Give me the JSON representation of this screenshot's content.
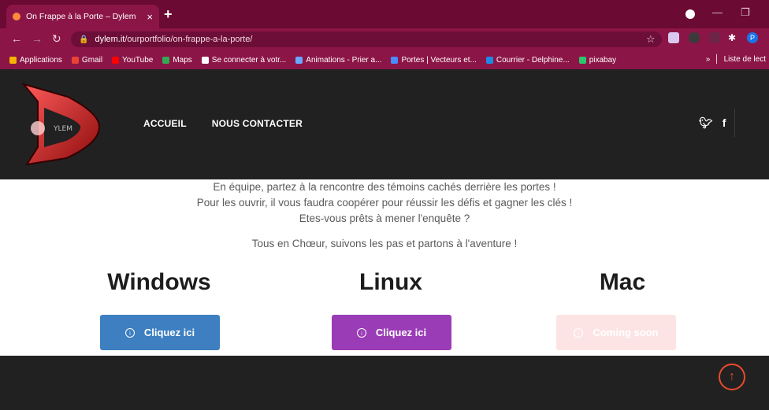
{
  "browser": {
    "tab_title": "On Frappe à la Porte – Dylem",
    "tab_close": "×",
    "new_tab": "+",
    "url_host": "dylem.it",
    "url_path": "/ourportfolio/on-frappe-a-la-porte/",
    "bookmarks": [
      {
        "label": "Applications",
        "color": "#f4b400"
      },
      {
        "label": "Gmail",
        "color": "#ea4335"
      },
      {
        "label": "YouTube",
        "color": "#ff0000"
      },
      {
        "label": "Maps",
        "color": "#34a853"
      },
      {
        "label": "Se connecter à votr...",
        "color": "#ffffff"
      },
      {
        "label": "Animations - Prier a...",
        "color": "#6aa7ff"
      },
      {
        "label": "Portes | Vecteurs et...",
        "color": "#4a8cff"
      },
      {
        "label": "Courrier - Delphine...",
        "color": "#1e88e5"
      },
      {
        "label": "pixabay",
        "color": "#2ec66b"
      }
    ],
    "bookmarks_more": "»",
    "reading_list": "Liste de lect",
    "profile_initial": "P"
  },
  "site": {
    "logo_text": "YLEM",
    "nav": [
      "ACCUEIL",
      "NOUS CONTACTER"
    ],
    "social": [
      "twitter-icon",
      "facebook-icon"
    ]
  },
  "content": {
    "intro_lines": [
      "En équipe, partez à la rencontre des témoins cachés derrière les portes !",
      "Pour les ouvrir, il vous faudra coopérer pour réussir les défis et gagner les clés !",
      "Etes-vous prêts à mener l'enquête ?"
    ],
    "tagline": "Tous en Chœur, suivons les pas et partons à l'aventure !",
    "downloads": [
      {
        "os": "Windows",
        "button": "Cliquez ici",
        "color": "#3d7fc0",
        "text_color": "#ffffff"
      },
      {
        "os": "Linux",
        "button": "Cliquez ici",
        "color": "#9b3cb7",
        "text_color": "#ffffff"
      },
      {
        "os": "Mac",
        "button": "Coming soon",
        "color": "#fde4e4",
        "text_color": "#ffffff"
      }
    ]
  },
  "colors": {
    "browser_dark": "#6b0a33",
    "browser_main": "#8c1547",
    "header_bg": "#212121",
    "accent": "#e94b2b"
  }
}
